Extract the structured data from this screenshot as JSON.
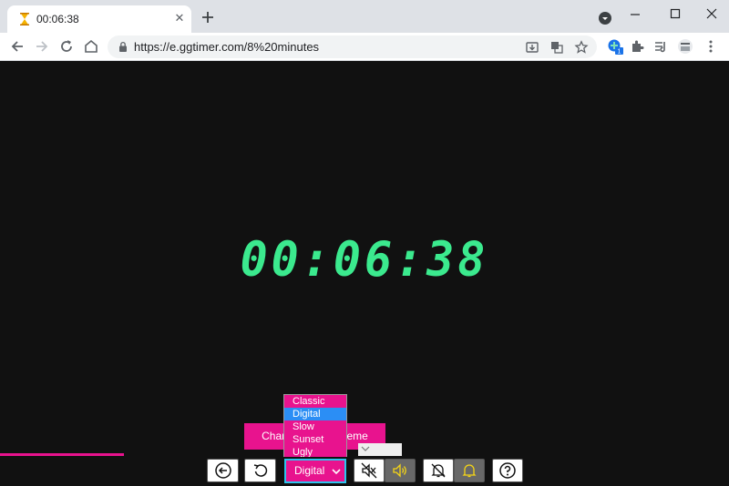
{
  "browser": {
    "tab_title": "00:06:38",
    "url": "https://e.ggtimer.com/8%20minutes",
    "extension_badge": "1"
  },
  "timer": {
    "display": "00:06:38",
    "color": "#3bea8e"
  },
  "theme": {
    "button_label": "Change theme",
    "button_label_left": "Chan",
    "button_label_right": "heme",
    "options": [
      "Classic",
      "Digital",
      "Slow",
      "Sunset",
      "Ugly"
    ],
    "selected": "Digital",
    "accent": "#e8138e"
  },
  "progress": {
    "fraction": 0.17
  },
  "controls": {
    "back": "back-icon",
    "restart": "restart-icon",
    "mute": "mute-icon",
    "sound": "sound-icon",
    "alarm_off": "bell-off-icon",
    "alarm_on": "bell-icon",
    "help": "help-icon"
  }
}
